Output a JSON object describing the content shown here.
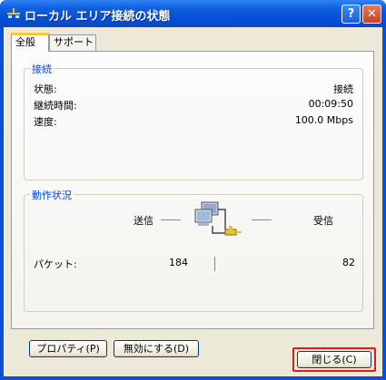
{
  "window": {
    "title": "ローカル エリア接続の状態",
    "help_button": "?",
    "close_button": "✕"
  },
  "tabs": [
    {
      "label": "全般",
      "active": true
    },
    {
      "label": "サポート",
      "active": false
    }
  ],
  "connection": {
    "group_title": "接続",
    "rows": [
      {
        "label": "状態:",
        "value": "接続"
      },
      {
        "label": "継続時間:",
        "value": "00:09:50"
      },
      {
        "label": "速度:",
        "value": "100.0 Mbps"
      }
    ]
  },
  "activity": {
    "group_title": "動作状況",
    "sent_label": "送信",
    "received_label": "受信",
    "packets_label": "パケット:",
    "packets_sent": "184",
    "packets_received": "82"
  },
  "buttons": {
    "properties": "プロパティ(P)",
    "disable": "無効にする(D)",
    "close": "閉じる(C)"
  },
  "colors": {
    "titlebar": "#0a4fd6",
    "group_title": "#0046d5",
    "highlight": "#e21a1a"
  }
}
